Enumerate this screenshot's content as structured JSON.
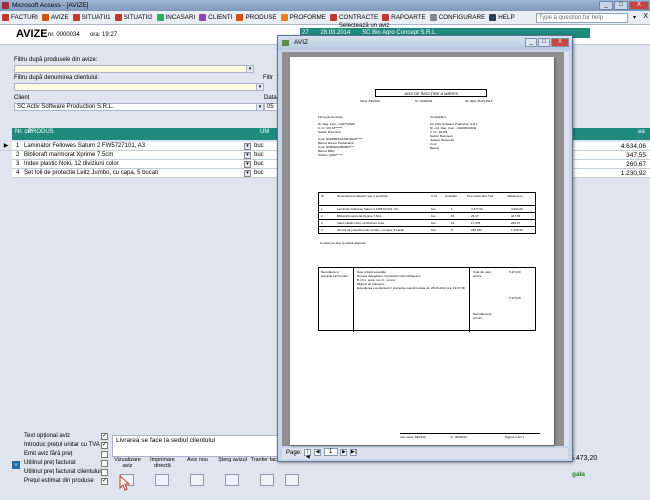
{
  "app": {
    "title": "Microsoft Access - [AVIZE]",
    "window_buttons": [
      "_",
      "□",
      "X"
    ]
  },
  "menu": {
    "items": [
      "FACTURI",
      "AVIZE",
      "SITUATII1",
      "SITUATII2",
      "INCASARI",
      "CLIENTI",
      "PRODUSE",
      "PROFORME",
      "CONTRACTE",
      "RAPOARTE",
      "CONFIGURARE",
      "HELP"
    ],
    "icon_colors": [
      "#c0392b",
      "#d35400",
      "#c0392b",
      "#c0392b",
      "#27ae60",
      "#8e44ad",
      "#d35400",
      "#e67e22",
      "#c0392b",
      "#c0392b",
      "#7f8c8d",
      "#2c3e50"
    ],
    "question_placeholder": "Type a question for help",
    "mdi_close": "X"
  },
  "form": {
    "title": "AVIZE",
    "nr_label": "nr. 0000034",
    "ora_label": "ora: 19:27",
    "filter_product_label": "Filtru după produsele din avize:",
    "filter_client_label": "Filtru după denumirea clientului:",
    "filter_client_label_right": "Filtr",
    "client_label": "Client",
    "client_value": "SC Activ Software Production S.R.L.",
    "date_label": "Data",
    "date_value": "05",
    "selector_label": "Selectează un aviz",
    "selector_values": [
      "27",
      "28.03.2014",
      "SC Bio Agro Concept S.R.L."
    ],
    "grid_headers": {
      "nr": "Nr. crt.",
      "produs": "PRODUS",
      "um": "UM",
      "right_value": "ea"
    },
    "rows": [
      {
        "nr": "1",
        "produs": "Laminator Fellowes Saturn 2 FW5727101, A3",
        "um": "buc",
        "value": "4.634,06"
      },
      {
        "nr": "2",
        "produs": "Biblioraft marmorat Xprime 7.5cm",
        "um": "buc",
        "value": "347,55"
      },
      {
        "nr": "3",
        "produs": "Index plastic Noki, 12 diviziuni color",
        "um": "buc",
        "value": "260,67"
      },
      {
        "nr": "4",
        "produs": "Set foli de protectie Leitz Jumbo, cu capa, 5 bucati",
        "um": "buc",
        "value": "1.230,92"
      }
    ],
    "row_selector": "▶",
    "checkboxes": [
      {
        "label": "Text opțional aviz",
        "checked": "✓"
      },
      {
        "label": "Introduc prețul unitar cu TVA",
        "checked": "✓"
      },
      {
        "label": "Emit aviz fără preț",
        "checked": ""
      },
      {
        "label": "Utilinul preț facturat",
        "checked": ""
      },
      {
        "label": "Utilinul preț facturat clientului",
        "checked": ""
      },
      {
        "label": "Prețul estimat din produse",
        "checked": "✓"
      }
    ],
    "note_text": "Livrarea se face la sediul clientului",
    "actions": [
      {
        "label": "Vizualizare aviz",
        "icon": "preview-icon"
      },
      {
        "label": "Imprimare directă",
        "icon": "printer-icon"
      },
      {
        "label": "Aviz nou",
        "icon": "new-document-icon"
      },
      {
        "label": "Șterg avizul",
        "icon": "delete-icon"
      },
      {
        "label": "Tranfer facturi",
        "icon": "transfer-icon"
      },
      {
        "label": "Ieșire",
        "icon": "exit-icon"
      }
    ],
    "total": "5.473,20",
    "gala_label": "gala"
  },
  "aviz_window": {
    "title": "AVIZ",
    "page_label": "Page:",
    "page_number": "1",
    "nav": [
      "|◀",
      "◀",
      "▶",
      "▶|"
    ],
    "document": {
      "title": "AVIZ DE ÎNSOȚIRE A MĂRFII",
      "serie_label": "Seria: DEVIOA",
      "nr_label": "Nr.: 0000034",
      "date_label": "din data: 05.03.2014",
      "furnizor_label": "Firma (denumirea)",
      "furnizor_lines": [
        "Nr. Reg. Com.: J40/7*/2009",
        "C.I.F.: RO 18******",
        "Sediul: Bucuresti",
        "Cont: RO08BTRL04501202D*****",
        "Banca: Banca Transilvania",
        "Cont: RO89RNCB0082****",
        "Banca: BRD",
        "Telefon: 0040******"
      ],
      "cumparator_label": "Cumpărător:",
      "cumparator_lines": [
        "SC Activ Software Production S.R.L.",
        "Nr. ord. Reg. Com.: J40/2002/2011",
        "C.I.F.: R1154",
        "Sediul: Bucuresti",
        "Judetul: Bucuresti",
        "Cont:",
        "Banca:"
      ],
      "table_headers": [
        "Nr.",
        "Denumirea produselor sau a serviciilor",
        "U.M.",
        "Cantitate",
        "Pret unitar fara TVA",
        "Valoarea lei"
      ],
      "table_rows": [
        [
          "1",
          "Laminator Fellowes Saturn 2 FW5727101, A3",
          "buc",
          "1",
          "4.377,03",
          "4.634,06"
        ],
        [
          "2",
          "Biblioraft marmorat Xprime 7.5cm",
          "buc",
          "15",
          "23,17",
          "347,55"
        ],
        [
          "3",
          "Index plastic Noki, 12 diviziuni color",
          "buc",
          "15",
          "17,378",
          "260,67"
        ],
        [
          "4",
          "Set foli de protectie Leitz Jumbo, cu capa, 5 bucati",
          "buc",
          "5",
          "246,184",
          "1.230,92"
        ]
      ],
      "note": "Livrarea se face la sediul clientului",
      "sign_furnizor": "Semnătura și ștampila furnizorului",
      "expeditie_label": "Date privind expediția",
      "expeditie_lines": [
        "Numele delegatului: Constantin Ciuru Mihaescu",
        "B.I./C.I. seria: xxx nr.: xxxxxx",
        "Mijlocul de transport:",
        "Expedierea s-a efectuat în prezența noastră la data de: 28.03.2014 ora: 19:27:48"
      ],
      "total_label": "Total din care: accize",
      "total_value": "5.473,20",
      "semnatura_primire": "Semnătura de primire",
      "footer": [
        "Aviz seria: DEVIOA",
        "nr.: 0000034",
        "Pagina 1 din 1"
      ]
    }
  }
}
